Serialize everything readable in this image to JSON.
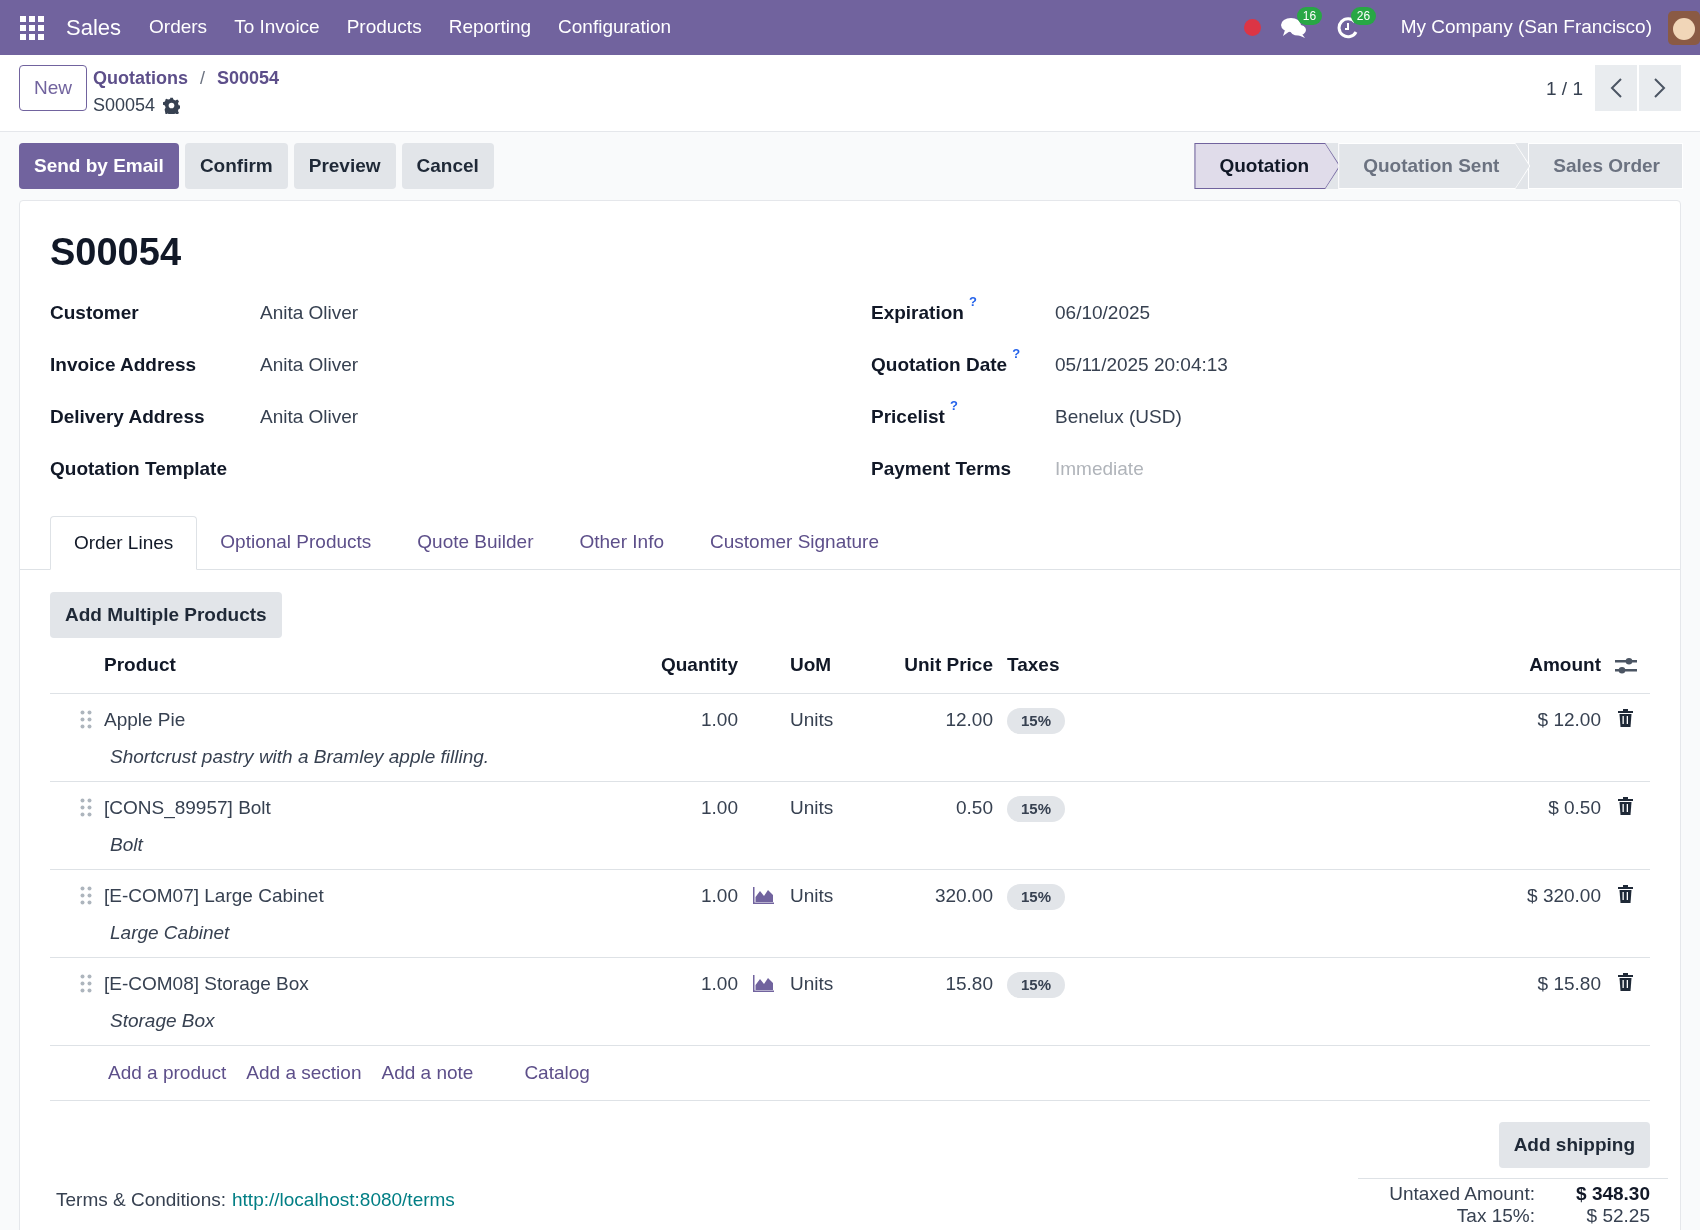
{
  "navbar": {
    "app": "Sales",
    "menu": [
      "Orders",
      "To Invoice",
      "Products",
      "Reporting",
      "Configuration"
    ],
    "messages_count": "16",
    "activities_count": "26",
    "company": "My Company (San Francisco)"
  },
  "control_panel": {
    "new_button": "New",
    "breadcrumb": [
      "Quotations",
      "S00054"
    ],
    "breadcrumb_separator": "/",
    "record": "S00054",
    "pager": "1 / 1"
  },
  "actions": [
    {
      "label": "Send by Email",
      "kind": "primary"
    },
    {
      "label": "Confirm",
      "kind": "secondary"
    },
    {
      "label": "Preview",
      "kind": "secondary"
    },
    {
      "label": "Cancel",
      "kind": "secondary"
    }
  ],
  "stages": [
    {
      "label": "Quotation",
      "selected": true
    },
    {
      "label": "Quotation Sent",
      "selected": false
    },
    {
      "label": "Sales Order",
      "selected": false
    }
  ],
  "title": "S00054",
  "fields_left": [
    {
      "label": "Customer",
      "value": "Anita Oliver",
      "help": false
    },
    {
      "label": "Invoice Address",
      "value": "Anita Oliver",
      "help": false
    },
    {
      "label": "Delivery Address",
      "value": "Anita Oliver",
      "help": false
    },
    {
      "label": "Quotation Template",
      "help": false
    }
  ],
  "fields_right": [
    {
      "label": "Expiration",
      "value": "06/10/2025",
      "help": true
    },
    {
      "label": "Quotation Date",
      "value": "05/11/2025 20:04:13",
      "help": true
    },
    {
      "label": "Pricelist",
      "value": "Benelux (USD)",
      "help": true
    },
    {
      "label": "Payment Terms",
      "placeholder": "Immediate",
      "help": false
    }
  ],
  "help_mark": "?",
  "tabs": [
    {
      "label": "Order Lines",
      "selected": true
    },
    {
      "label": "Optional Products",
      "selected": false
    },
    {
      "label": "Quote Builder",
      "selected": false
    },
    {
      "label": "Other Info",
      "selected": false
    },
    {
      "label": "Customer Signature",
      "selected": false
    }
  ],
  "add_multiple": "Add Multiple Products",
  "table": {
    "columns": [
      "Product",
      "Quantity",
      "UoM",
      "Unit Price",
      "Taxes",
      "Amount"
    ],
    "rows": [
      {
        "product": "Apple Pie",
        "description": "Shortcrust pastry with a Bramley apple filling.",
        "quantity": "1.00",
        "forecast": false,
        "uom": "Units",
        "unit_price": "12.00",
        "tax": "15%",
        "amount": "$ 12.00"
      },
      {
        "product": "[CONS_89957] Bolt",
        "description": "Bolt",
        "quantity": "1.00",
        "forecast": false,
        "uom": "Units",
        "unit_price": "0.50",
        "tax": "15%",
        "amount": "$ 0.50"
      },
      {
        "product": "[E-COM07] Large Cabinet",
        "description": "Large Cabinet",
        "quantity": "1.00",
        "forecast": true,
        "uom": "Units",
        "unit_price": "320.00",
        "tax": "15%",
        "amount": "$ 320.00"
      },
      {
        "product": "[E-COM08] Storage Box",
        "description": "Storage Box",
        "quantity": "1.00",
        "forecast": true,
        "uom": "Units",
        "unit_price": "15.80",
        "tax": "15%",
        "amount": "$ 15.80"
      }
    ],
    "add_links": [
      {
        "label": "Add a product",
        "kind": "line"
      },
      {
        "label": "Add a section",
        "kind": "line"
      },
      {
        "label": "Add a note",
        "kind": "line"
      },
      {
        "label": "Catalog",
        "kind": "catalog"
      }
    ]
  },
  "add_shipping": "Add shipping",
  "terms": {
    "label": "Terms & Conditions:",
    "link": "http://localhost:8080/terms"
  },
  "totals": [
    {
      "label": "Untaxed Amount:",
      "value": "$ 348.30"
    },
    {
      "label": "Tax 15%:",
      "value": "$ 52.25"
    }
  ]
}
